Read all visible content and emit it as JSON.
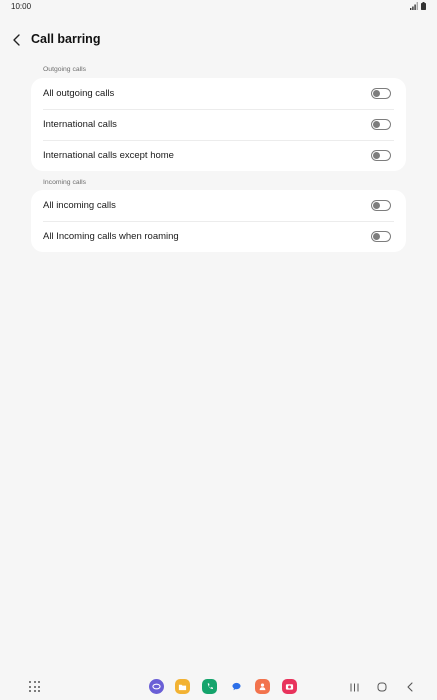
{
  "status_bar": {
    "time": "10:00",
    "icons": [
      "signal-icon",
      "battery-icon"
    ]
  },
  "header": {
    "title": "Call barring",
    "back_icon": "chevron-left-icon"
  },
  "sections": [
    {
      "label": "Outgoing calls",
      "items": [
        {
          "label": "All outgoing calls",
          "enabled": false
        },
        {
          "label": "International calls",
          "enabled": false
        },
        {
          "label": "International calls except home",
          "enabled": false
        }
      ]
    },
    {
      "label": "Incoming calls",
      "items": [
        {
          "label": "All incoming calls",
          "enabled": false
        },
        {
          "label": "All Incoming calls when roaming",
          "enabled": false
        }
      ]
    }
  ],
  "nav_bar": {
    "apps_icon": "apps-grid-icon",
    "dock_apps": [
      {
        "name": "internet-app-icon",
        "color": "#6a5fd6"
      },
      {
        "name": "files-app-icon",
        "color": "#f2b233"
      },
      {
        "name": "phone-app-icon",
        "color": "#15a46c"
      },
      {
        "name": "messages-app-icon",
        "color": "#2c6fe8"
      },
      {
        "name": "contacts-app-icon",
        "color": "#f2734d"
      },
      {
        "name": "camera-app-icon",
        "color": "#e8335c"
      }
    ],
    "buttons": [
      "recents-icon",
      "home-icon",
      "back-icon"
    ]
  },
  "colors": {
    "background": "#f6f6f6",
    "card": "#ffffff",
    "toggle_off": "#7d7d7d"
  }
}
